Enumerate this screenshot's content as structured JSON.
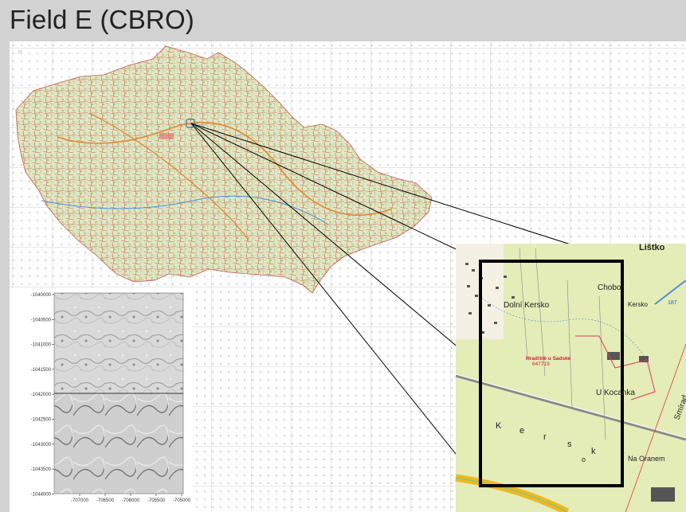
{
  "title": "Field E (CBRO)",
  "toolbar": {
    "zoom_icon": "magnifier-icon"
  },
  "lidar": {
    "y_ticks": [
      "-1040000",
      "-1040500",
      "-1041000",
      "-1041500",
      "-1042000",
      "-1042500",
      "-1043000",
      "-1043500",
      "-1044000"
    ],
    "x_ticks": [
      "-707000",
      "-706500",
      "-706000",
      "-705500",
      "-705000"
    ]
  },
  "detail_map": {
    "top_label": "Lištko",
    "labels": [
      "Chobot",
      "Dolní Kersko",
      "Hradiště u Sadské",
      "647719",
      "U Kocanka",
      "K",
      "e",
      "r",
      "s",
      "k",
      "o",
      "Na Oranem",
      "Kersko",
      "187",
      "Smírad",
      "U"
    ]
  },
  "colors": {
    "frame": "#000000",
    "background": "#d2d2d2",
    "map_green": "#dfe8b0",
    "roads": "#d83a3a"
  }
}
